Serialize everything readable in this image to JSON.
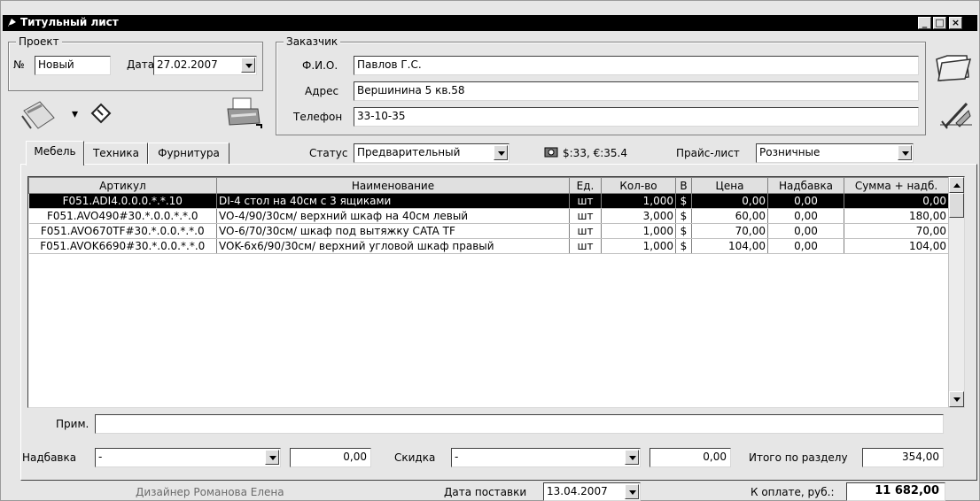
{
  "window": {
    "title": "Титульный лист",
    "buttons": [
      "_",
      "□",
      "×"
    ]
  },
  "project": {
    "group_label": "Проект",
    "number_label": "№",
    "number_value": "Новый",
    "date_label": "Дата",
    "date_value": "27.02.2007"
  },
  "customer": {
    "group_label": "Заказчик",
    "name_label": "Ф.И.О.",
    "name_value": "Павлов Г.С.",
    "address_label": "Адрес",
    "address_value": "Вершинина 5 кв.58",
    "phone_label": "Телефон",
    "phone_value": "33-10-35"
  },
  "status_row": {
    "status_label": "Статус",
    "status_value": "Предварительный",
    "currency_rates": "$:33, €:35.4",
    "pricelist_label": "Прайс-лист",
    "pricelist_value": "Розничные"
  },
  "tabs": [
    {
      "label": "Мебель",
      "active": true
    },
    {
      "label": "Техника",
      "active": false
    },
    {
      "label": "Фурнитура",
      "active": false
    }
  ],
  "grid": {
    "columns": [
      "Артикул",
      "Наименование",
      "Ед.",
      "Кол-во",
      "В",
      "Цена",
      "Надбавка",
      "Сумма + надб."
    ],
    "rows": [
      [
        "F051.ADI4.0.0.0.*.*.10",
        "DI-4 стол на 40см с 3 ящиками",
        "шт",
        "1,000",
        "$",
        "0,00",
        "0,00",
        "0,00"
      ],
      [
        "F051.AVO490#30.*.0.0.*.*.0",
        "VO-4/90/30см/ верхний шкаф на 40см левый",
        "шт",
        "3,000",
        "$",
        "60,00",
        "0,00",
        "180,00"
      ],
      [
        "F051.AVO670TF#30.*.0.0.*.*.0",
        "VO-6/70/30см/ шкаф под вытяжку CATA TF",
        "шт",
        "1,000",
        "$",
        "70,00",
        "0,00",
        "70,00"
      ],
      [
        "F051.AVOK6690#30.*.0.0.*.*.0",
        "VOK-6х6/90/30см/ верхний угловой шкаф правый",
        "шт",
        "1,000",
        "$",
        "104,00",
        "0,00",
        "104,00"
      ]
    ],
    "selected_row": 0
  },
  "footer": {
    "note_label": "Прим.",
    "note_value": "",
    "markup_label": "Надбавка",
    "markup_combo": "-",
    "markup_value": "0,00",
    "discount_label": "Скидка",
    "discount_combo": "-",
    "discount_value": "0,00",
    "section_total_label": "Итого по разделу",
    "section_total_value": "354,00"
  },
  "statusbar": {
    "designer": "Дизайнер Романова Елена",
    "delivery_label": "Дата поставки",
    "delivery_value": "13.04.2007",
    "payment_label": "К оплате, руб.:",
    "payment_value": "11 682,00"
  },
  "icons": [
    "app-icon",
    "pencil-tool-icon",
    "diskette-icon",
    "printer-icon",
    "open-folder-icon",
    "drafting-tools-icon",
    "coins-icon"
  ]
}
